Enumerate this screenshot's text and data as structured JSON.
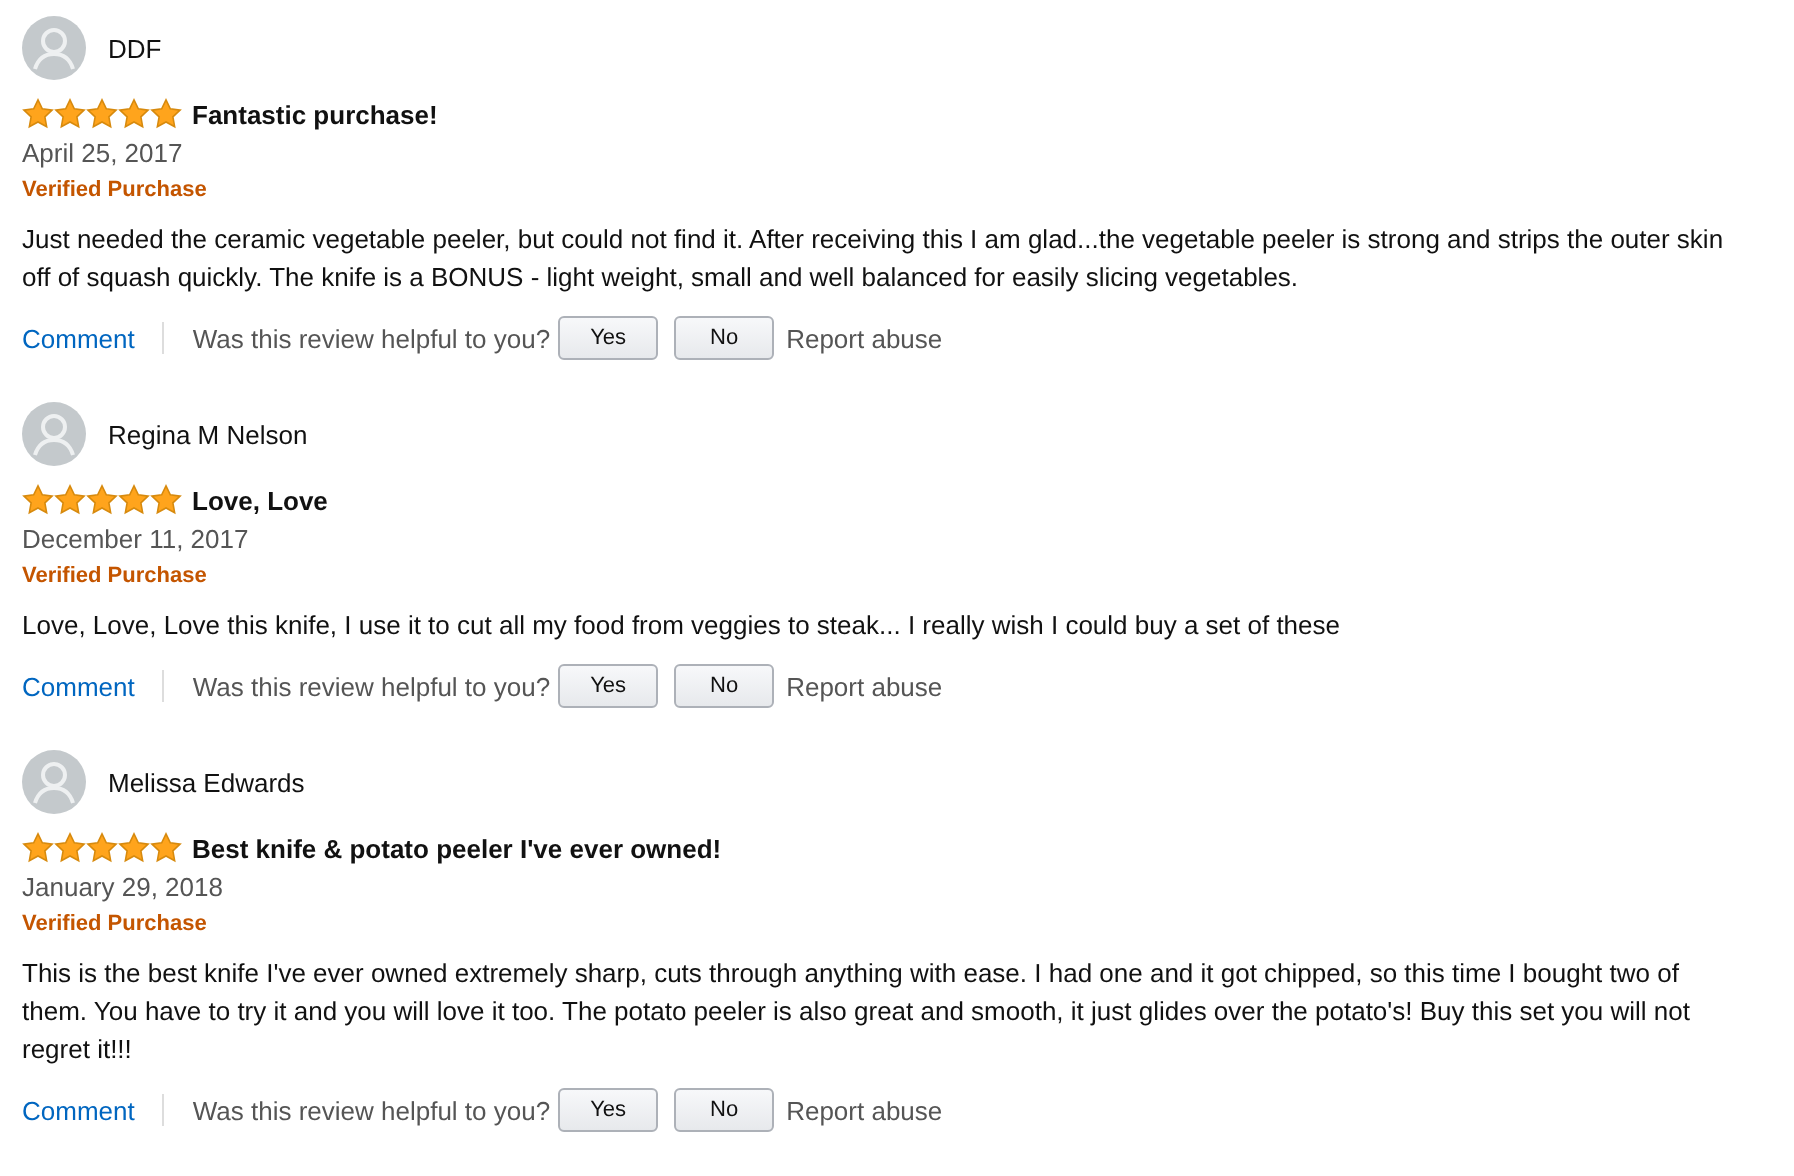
{
  "reviews": [
    {
      "author": "DDF",
      "stars": 5,
      "title": "Fantastic purchase!",
      "date": "April 25, 2017",
      "badge": "Verified Purchase",
      "body": "Just needed the ceramic vegetable peeler, but could not find it. After receiving this I am glad...the vegetable peeler is strong and strips the outer skin off of squash quickly. The knife is a BONUS - light weight, small and well balanced for easily slicing vegetables.",
      "comment": "Comment",
      "question": "Was this review helpful to you?",
      "yes": "Yes",
      "no": "No",
      "report": "Report abuse"
    },
    {
      "author": "Regina M Nelson",
      "stars": 5,
      "title": "Love, Love",
      "date": "December 11, 2017",
      "badge": "Verified Purchase",
      "body": "Love, Love, Love this knife, I use it to cut all my food from veggies to steak... I really wish I could buy a set of these",
      "comment": "Comment",
      "question": "Was this review helpful to you?",
      "yes": "Yes",
      "no": "No",
      "report": "Report abuse"
    },
    {
      "author": "Melissa Edwards",
      "stars": 5,
      "title": "Best knife & potato peeler I've ever owned!",
      "date": "January 29, 2018",
      "badge": "Verified Purchase",
      "body": "This is the best knife I've ever owned extremely sharp, cuts through anything with ease. I had one and it got chipped, so this time I bought two of them. You have to try it and you will love it too. The potato peeler is also great and smooth, it just glides over the potato's! Buy this set you will not regret it!!!",
      "comment": "Comment",
      "question": "Was this review helpful to you?",
      "yes": "Yes",
      "no": "No",
      "report": "Report abuse"
    }
  ]
}
